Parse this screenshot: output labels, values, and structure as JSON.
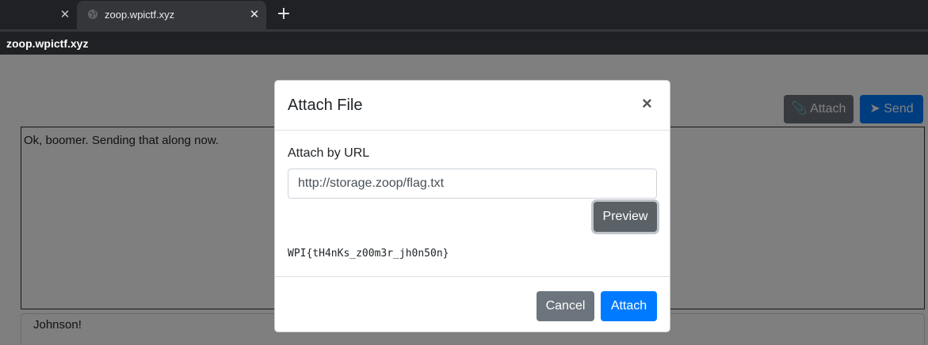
{
  "browser": {
    "tab_title": "zoop.wpictf.xyz",
    "tab_close": "✕",
    "prev_tab_close": "✕",
    "new_tab": "+",
    "url": "zoop.wpictf.xyz"
  },
  "page": {
    "attach_button": "📎 Attach",
    "send_button": "➤ Send",
    "chat_text": "Ok, boomer. Sending that along now.",
    "message_text": "Johnson!"
  },
  "modal": {
    "title": "Attach File",
    "close_glyph": "×",
    "url_label": "Attach by URL",
    "url_value": "http://storage.zoop/flag.txt",
    "preview_button": "Preview",
    "preview_result": "WPI{tH4nKs_z00m3r_jh0n50n}",
    "cancel_button": "Cancel",
    "attach_button": "Attach"
  }
}
